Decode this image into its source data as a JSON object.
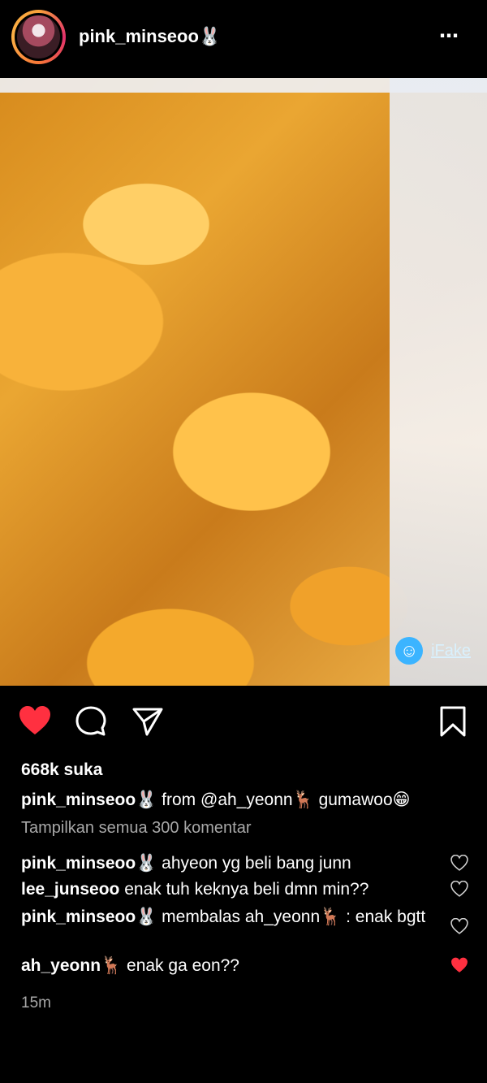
{
  "header": {
    "username": "pink_minseoo🐰",
    "more_icon": "⋯"
  },
  "post": {
    "watermark_text": "iFake",
    "watermark_icon": "☺"
  },
  "actions": {
    "like_state": "liked",
    "like_color": "#ff3040"
  },
  "stats": {
    "likes": "668k suka"
  },
  "caption": {
    "username": "pink_minseoo🐰",
    "text": " from @ah_yeonn🦌 gumawoo😁"
  },
  "comments": {
    "view_all": "Tampilkan semua 300 komentar",
    "items": [
      {
        "username": "pink_minseoo🐰",
        "text": " ahyeon yg beli bang junn",
        "liked": false
      },
      {
        "username": "lee_junseoo",
        "text": " enak tuh keknya beli dmn min??",
        "liked": false
      },
      {
        "username": "pink_minseoo🐰",
        "text": " membalas ah_yeonn🦌 : enak bgtt",
        "liked": false
      },
      {
        "username": "ah_yeonn🦌",
        "text": " enak ga eon??",
        "liked": true
      }
    ]
  },
  "meta": {
    "time_ago": "15m"
  }
}
